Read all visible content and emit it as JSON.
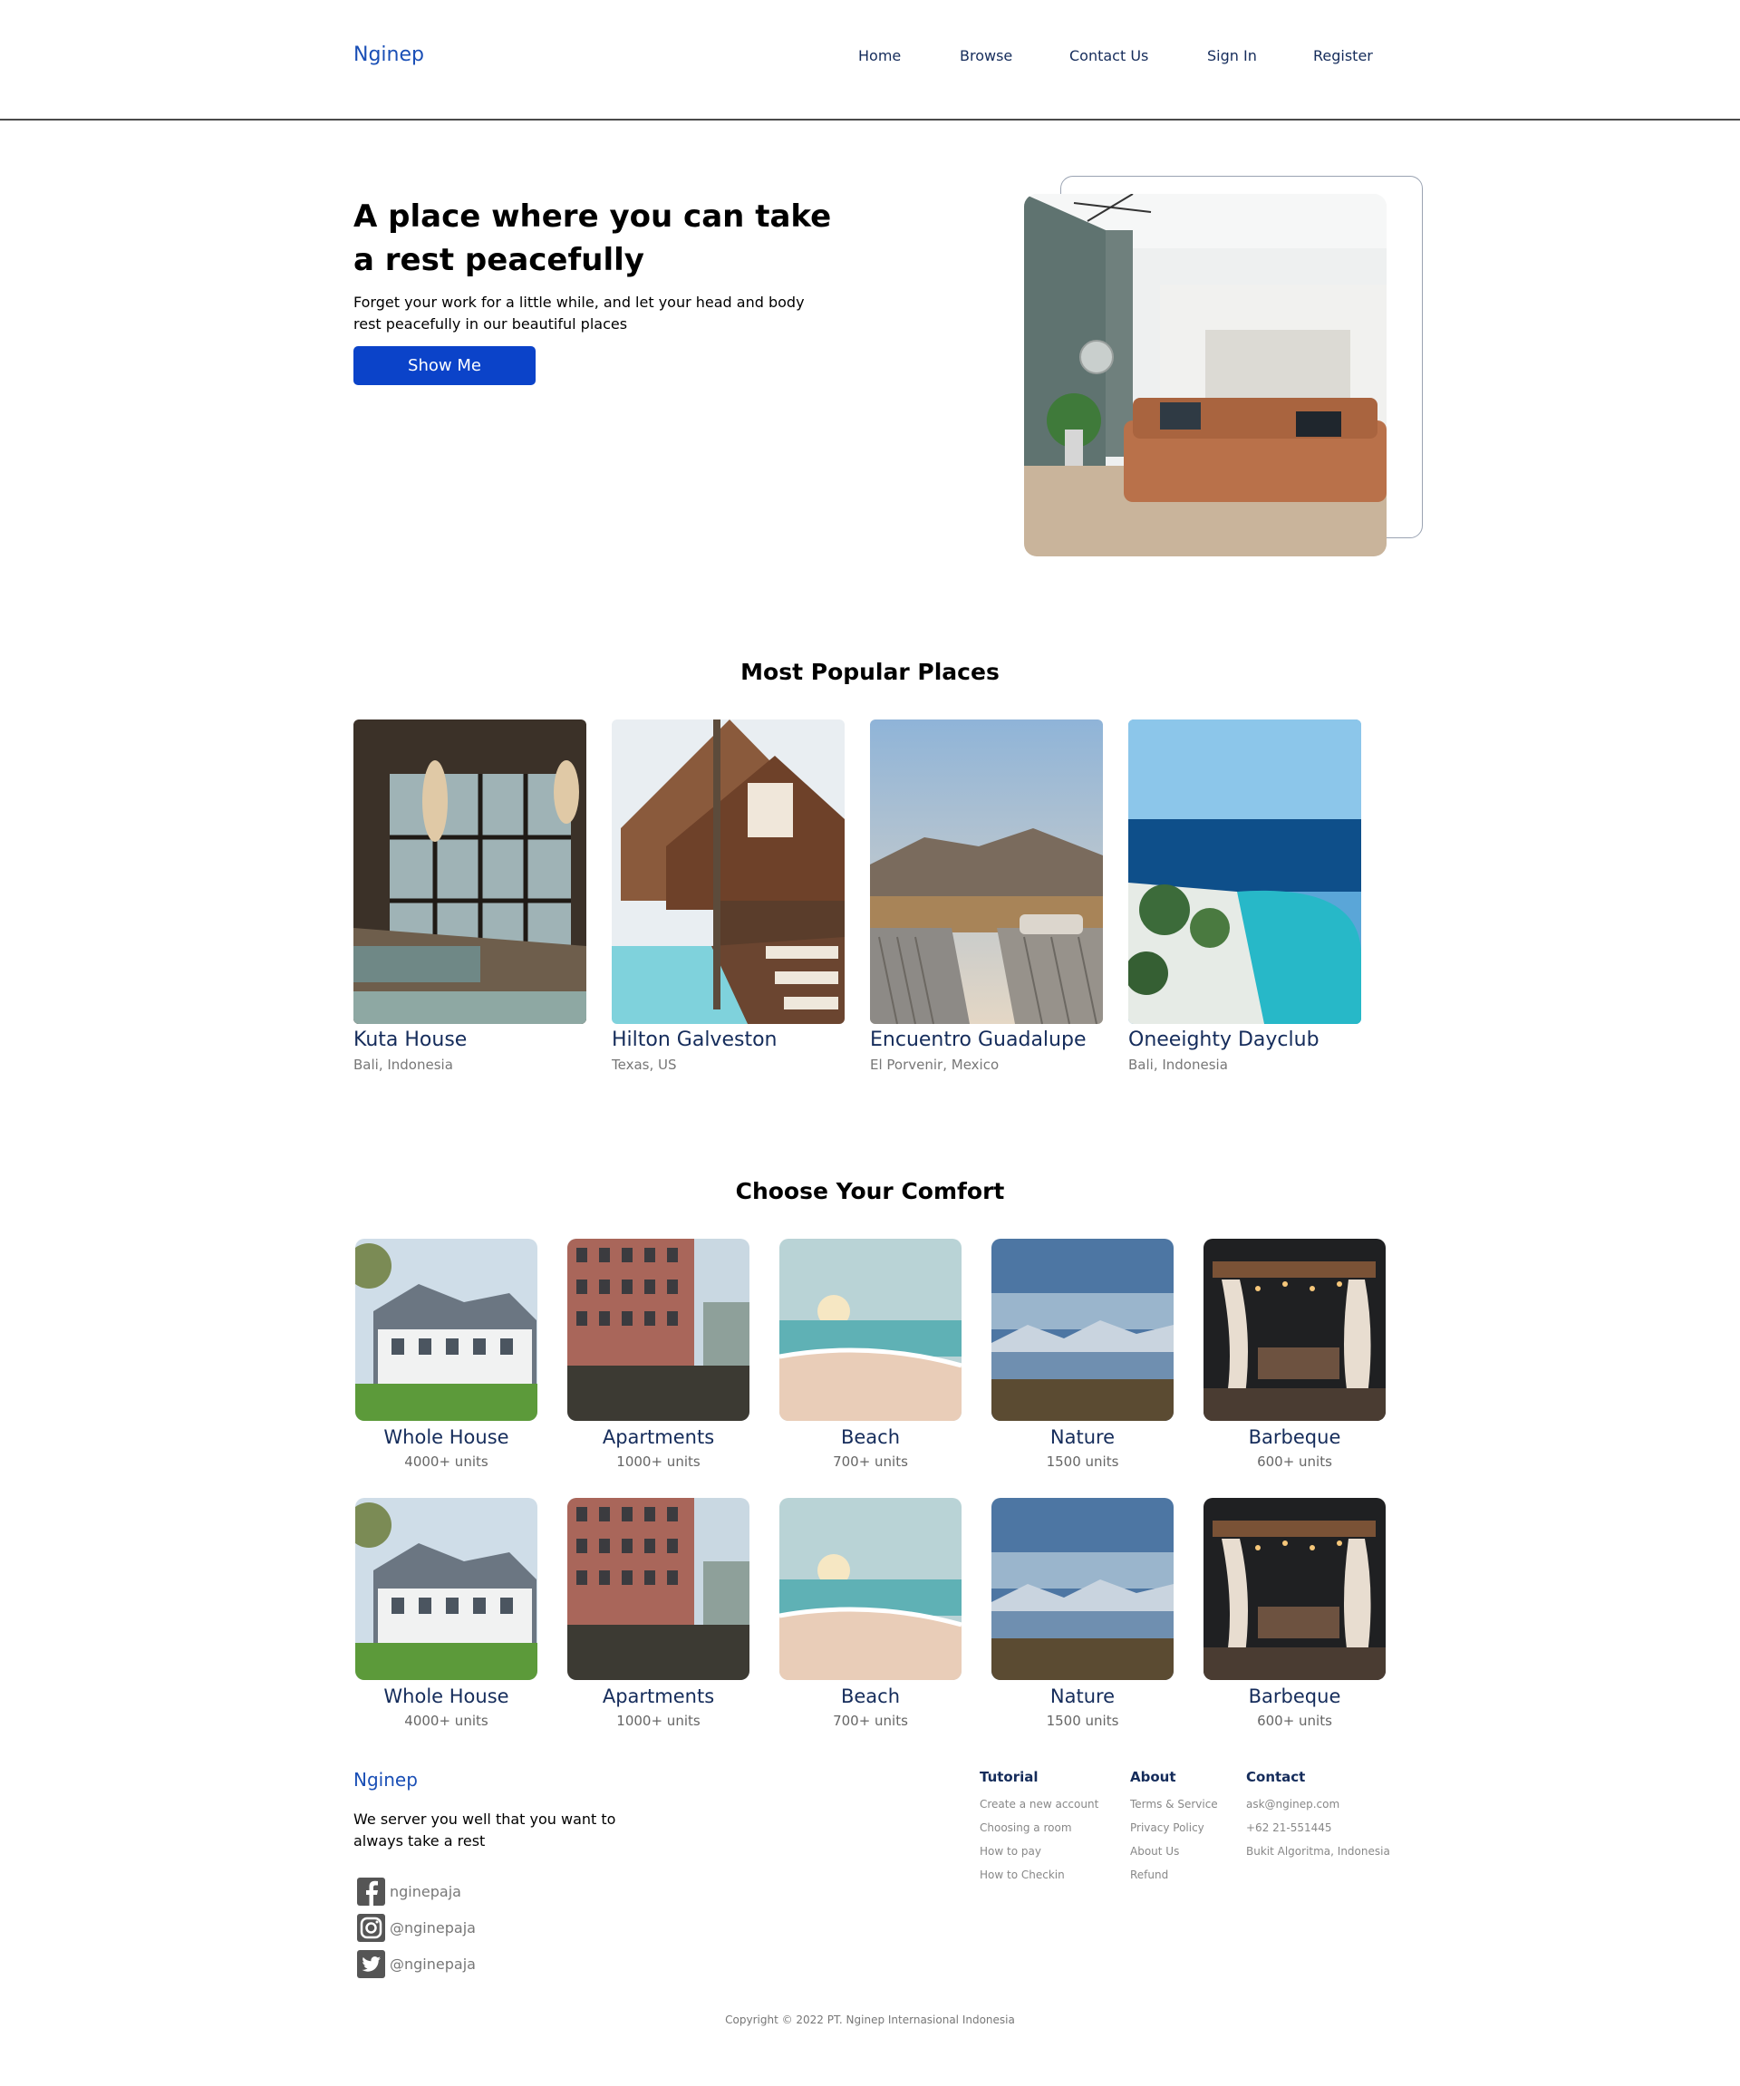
{
  "header": {
    "logo": "Nginep",
    "nav": [
      {
        "label": "Home"
      },
      {
        "label": "Browse"
      },
      {
        "label": "Contact Us"
      },
      {
        "label": "Sign In"
      },
      {
        "label": "Register"
      }
    ]
  },
  "hero": {
    "title_plain": "A place where you can ",
    "title_bold": "take a rest peacefully",
    "description": "Forget your work for a little while, and let your head and body rest peacefully in our beautiful places",
    "button_label": "Show Me"
  },
  "popular": {
    "title": "Most Popular Places",
    "places": [
      {
        "name": "Kuta House",
        "location": "Bali, Indonesia"
      },
      {
        "name": "Hilton Galveston",
        "location": "Texas, US"
      },
      {
        "name": "Encuentro Guadalupe",
        "location": "El Porvenir, Mexico"
      },
      {
        "name": "Oneeighty Dayclub",
        "location": "Bali, Indonesia"
      }
    ]
  },
  "comfort": {
    "title": "Choose Your Comfort",
    "rows": [
      [
        {
          "name": "Whole House",
          "units": "4000+ units"
        },
        {
          "name": "Apartments",
          "units": "1000+ units"
        },
        {
          "name": "Beach",
          "units": "700+ units"
        },
        {
          "name": "Nature",
          "units": "1500 units"
        },
        {
          "name": "Barbeque",
          "units": "600+ units"
        }
      ],
      [
        {
          "name": "Whole House",
          "units": "4000+ units"
        },
        {
          "name": "Apartments",
          "units": "1000+ units"
        },
        {
          "name": "Beach",
          "units": "700+ units"
        },
        {
          "name": "Nature",
          "units": "1500 units"
        },
        {
          "name": "Barbeque",
          "units": "600+ units"
        }
      ]
    ]
  },
  "footer": {
    "logo": "Nginep",
    "tagline": "We server you well that you want to always take a rest",
    "social": [
      {
        "icon": "facebook-icon",
        "handle": "nginepaja"
      },
      {
        "icon": "instagram-icon",
        "handle": "@nginepaja"
      },
      {
        "icon": "twitter-icon",
        "handle": "@nginepaja"
      }
    ],
    "columns": [
      {
        "title": "Tutorial",
        "links": [
          "Create a new account",
          "Choosing a room",
          "How to pay",
          "How to Checkin"
        ]
      },
      {
        "title": "About",
        "links": [
          "Terms & Service",
          "Privacy Policy",
          "About Us",
          "Refund"
        ]
      },
      {
        "title": "Contact",
        "links": [
          "ask@nginep.com",
          "+62 21-551445",
          "Bukit Algoritma, Indonesia"
        ]
      }
    ],
    "copyright": "Copyright © 2022 PT. Nginep Internasional Indonesia"
  },
  "colors": {
    "brand": "#1a4fb6",
    "button": "#0b43c9",
    "heading_text": "#152c5b",
    "muted_text": "#777777"
  }
}
